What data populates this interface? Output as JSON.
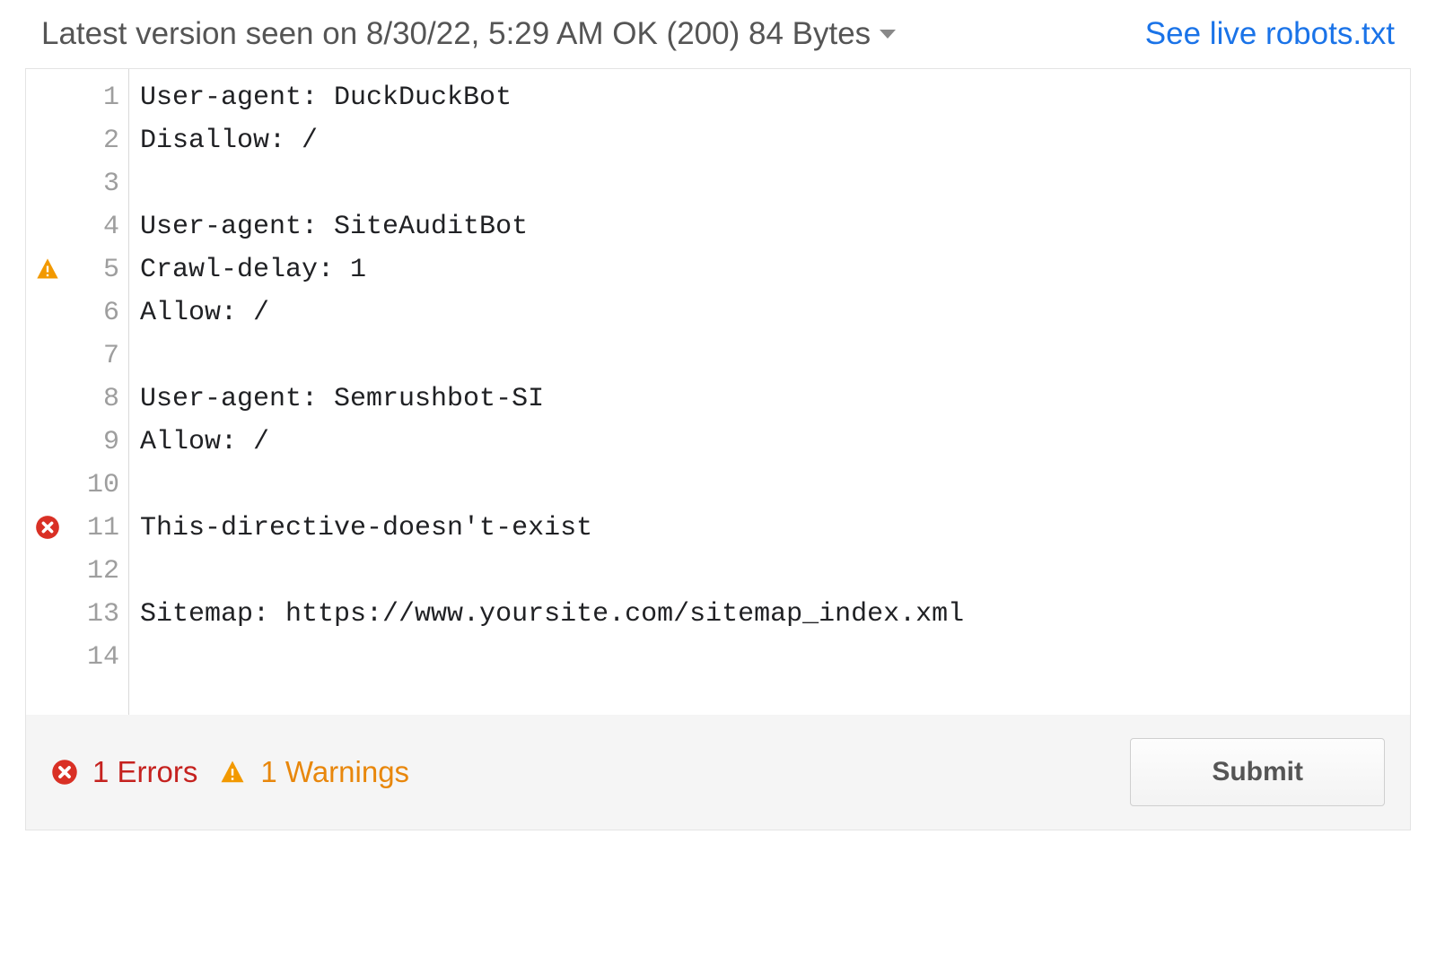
{
  "header": {
    "version_label": "Latest version seen on 8/30/22, 5:29 AM OK (200) 84 Bytes",
    "live_link_label": "See live robots.txt"
  },
  "editor": {
    "lines": [
      {
        "n": 1,
        "text": "User-agent: DuckDuckBot",
        "marker": null
      },
      {
        "n": 2,
        "text": "Disallow: /",
        "marker": null
      },
      {
        "n": 3,
        "text": "",
        "marker": null
      },
      {
        "n": 4,
        "text": "User-agent: SiteAuditBot",
        "marker": null
      },
      {
        "n": 5,
        "text": "Crawl-delay: 1",
        "marker": "warning"
      },
      {
        "n": 6,
        "text": "Allow: /",
        "marker": null
      },
      {
        "n": 7,
        "text": "",
        "marker": null
      },
      {
        "n": 8,
        "text": "User-agent: Semrushbot-SI",
        "marker": null
      },
      {
        "n": 9,
        "text": "Allow: /",
        "marker": null
      },
      {
        "n": 10,
        "text": "",
        "marker": null
      },
      {
        "n": 11,
        "text": "This-directive-doesn't-exist",
        "marker": "error"
      },
      {
        "n": 12,
        "text": "",
        "marker": null
      },
      {
        "n": 13,
        "text": "Sitemap: https://www.yoursite.com/sitemap_index.xml",
        "marker": null
      },
      {
        "n": 14,
        "text": "",
        "marker": null
      }
    ]
  },
  "footer": {
    "errors_count": "1",
    "errors_label": "Errors",
    "warnings_count": "1",
    "warnings_label": "Warnings",
    "submit_label": "Submit"
  }
}
